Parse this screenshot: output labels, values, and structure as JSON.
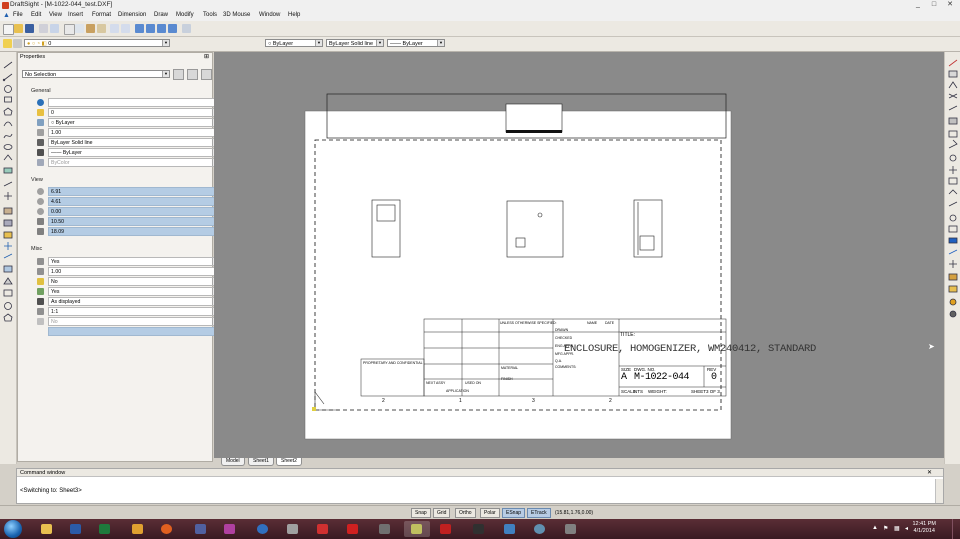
{
  "window": {
    "title": "DraftSight - [M-1022-044_test.DXF]",
    "controls": [
      "_",
      "□",
      "✕"
    ]
  },
  "menu": [
    "File",
    "Edit",
    "View",
    "Insert",
    "Format",
    "Dimension",
    "Draw",
    "Modify",
    "Tools",
    "3D Mouse",
    "Window",
    "Help"
  ],
  "layer_bar": {
    "layer_value": "0",
    "color_value": "ByLayer",
    "linestyle_value": "ByLayer",
    "linestyle_type": "Solid line",
    "lineweight_value": "—— ByLayer"
  },
  "properties": {
    "title": "Properties",
    "selection": "No Selection",
    "sections": {
      "general": "General",
      "view": "View",
      "misc": "Misc"
    },
    "general_rows": [
      "",
      "0",
      "ByLayer",
      "1.00",
      "ByLayer    Solid line",
      "ByLayer",
      "ByColor"
    ],
    "view_rows": [
      "6.91",
      "4.61",
      "0.00",
      "10.50",
      "18.09"
    ],
    "misc_rows": [
      "Yes",
      "1.00",
      "No",
      "Yes",
      "As displayed",
      "1:1",
      "No",
      ""
    ]
  },
  "drawing": {
    "title_label": "TITLE:",
    "title_text": "ENCLOSURE, HOMOGENIZER, WM240412, STANDARD",
    "size_label": "SIZE",
    "size_value": "A",
    "dwg_no_label": "DWG. NO.",
    "dwg_no_value": "M-1022-044",
    "rev_label": "REV",
    "rev_value": "0",
    "scale_label": "SCALE",
    "scale_value": "NTS",
    "weight_label": "WEIGHT:",
    "sheet_label": "SHEET",
    "sheet_value": "3 OF 3",
    "zone_numbers": [
      "2",
      "1",
      "3",
      "2"
    ],
    "unless_note": "UNLESS OTHERWISE SPECIFIED:",
    "proprietary_note": "PROPRIETARY AND CONFIDENTIAL",
    "name_label": "NAME",
    "date_label": "DATE",
    "drawn_label": "DRAWN",
    "checked_label": "CHECKED",
    "eng_label": "ENG APPR.",
    "mfg_label": "MFG APPR.",
    "qa_label": "Q.A.",
    "comments_label": "COMMENTS:",
    "finish_label": "FINISH",
    "material_label": "MATERIAL",
    "next_assy_label": "NEXT ASSY",
    "used_on_label": "USED ON",
    "application_label": "APPLICATION"
  },
  "tabs": [
    "Model",
    "Sheet1",
    "Sheet2"
  ],
  "active_tab": "Sheet2",
  "command_window": {
    "title": "Command window",
    "text": "<Switching to: Sheet3>"
  },
  "status": {
    "buttons": [
      "Snap",
      "Grid",
      "Ortho",
      "Polar",
      "ESnap",
      "ETrack"
    ],
    "active": [
      "ESnap",
      "ETrack"
    ],
    "coords": "(15.81,1.76,0.00)"
  },
  "taskbar": {
    "time": "12:41 PM",
    "date": "4/1/2014"
  },
  "colors": {
    "accent": "#3a6ea5",
    "row_blue": "#b4cce4",
    "taskbar": "#4a2430"
  }
}
